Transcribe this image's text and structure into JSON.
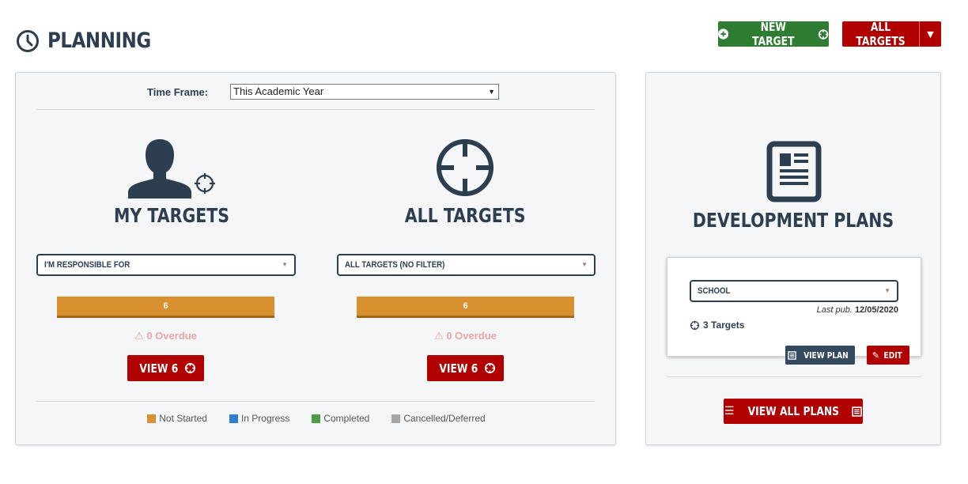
{
  "header": {
    "title": "PLANNING",
    "icon": "clock-icon",
    "new_target_label": "NEW TARGET",
    "all_targets_label": "ALL TARGETS"
  },
  "timeframe": {
    "label": "Time Frame:",
    "value": "This Academic Year"
  },
  "my_targets": {
    "title": "MY TARGETS",
    "filter": "I'M RESPONSIBLE FOR",
    "count": "6",
    "overdue": "0 Overdue",
    "view_label": "VIEW 6"
  },
  "all_targets": {
    "title": "ALL TARGETS",
    "filter": "ALL TARGETS (NO FILTER)",
    "count": "6",
    "overdue": "0 Overdue",
    "view_label": "VIEW 6"
  },
  "legend": [
    {
      "label": "Not Started",
      "color": "#d9902f"
    },
    {
      "label": "In Progress",
      "color": "#2f7fce"
    },
    {
      "label": "Completed",
      "color": "#4e9a47"
    },
    {
      "label": "Cancelled/Deferred",
      "color": "#a6a6a6"
    }
  ],
  "dev_plans": {
    "title": "DEVELOPMENT PLANS",
    "plan_select": "SCHOOL",
    "last_pub_label": "Last pub.",
    "last_pub_date": "12/05/2020",
    "targets_count": "3 Targets",
    "view_plan_label": "VIEW PLAN",
    "edit_label": "EDIT",
    "view_all_label": "VIEW ALL PLANS"
  },
  "colors": {
    "primary_dark": "#2c3e50",
    "red": "#b00000",
    "green": "#2e7d32",
    "progress_orange": "#d9902f"
  }
}
